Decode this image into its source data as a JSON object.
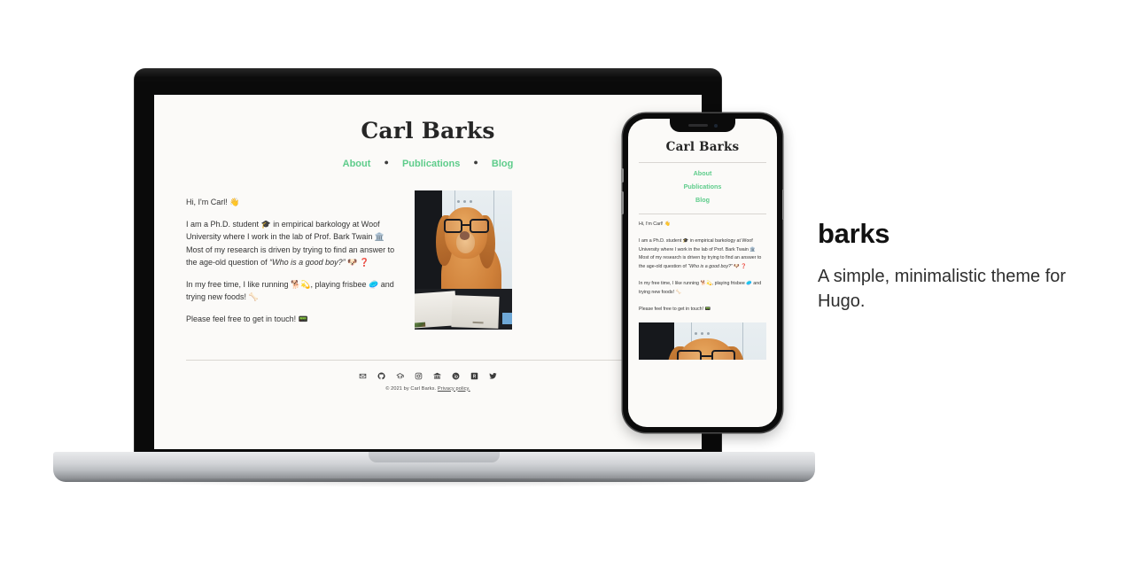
{
  "site": {
    "title": "Carl Barks",
    "nav": [
      {
        "label": "About"
      },
      {
        "label": "Publications"
      },
      {
        "label": "Blog"
      }
    ],
    "nav_separator": "●",
    "body": {
      "greeting": "Hi, I'm Carl! 👋",
      "para_intro_a": "I am a Ph.D. student 🎓 in empirical barkology at Woof University where I work in the lab of Prof. Bark Twain 🏛️ Most of my research is driven by trying to find an answer to the age-old question of ",
      "para_intro_quote": "“Who is a good boy?”",
      "para_intro_b": " 🐶 ❓",
      "para_hobbies": "In my free time, I like running 🐕💫, playing frisbee 🥏 and trying new foods! 🦴",
      "para_contact": "Please feel free to get in touch! 📟"
    },
    "photo": {
      "alt": "dog-with-glasses-reading-photo"
    },
    "footer": {
      "social": [
        {
          "name": "email-icon",
          "label": "Email"
        },
        {
          "name": "github-icon",
          "label": "GitHub"
        },
        {
          "name": "google-scholar-icon",
          "label": "Google Scholar"
        },
        {
          "name": "instagram-icon",
          "label": "Instagram"
        },
        {
          "name": "university-icon",
          "label": "University"
        },
        {
          "name": "orcid-icon",
          "label": "ORCID"
        },
        {
          "name": "researchgate-icon",
          "label": "ResearchGate"
        },
        {
          "name": "twitter-icon",
          "label": "Twitter"
        }
      ],
      "copyright": "© 2021 by Carl Barks. ",
      "privacy": "Privacy policy."
    }
  },
  "panel": {
    "title": "barks",
    "description": "A simple, minimalistic theme for Hugo."
  },
  "colors": {
    "page_background": "#fbfaf8",
    "accent_green": "#5ecc8b",
    "text": "#2f2f2f",
    "heading": "#111111",
    "bezel": "#0b0b0b"
  }
}
